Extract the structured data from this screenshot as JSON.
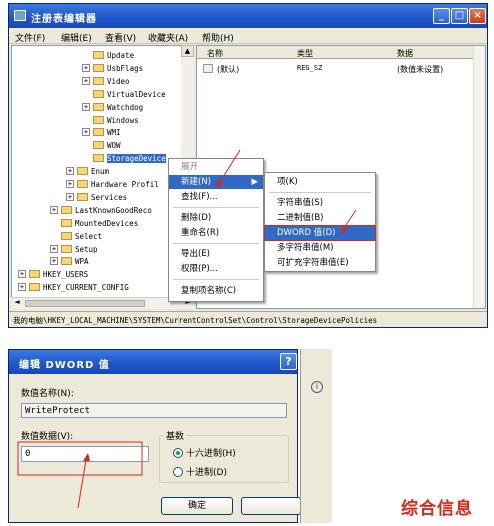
{
  "regedit": {
    "title": "注册表编辑器",
    "menu": [
      "文件(F)",
      "编辑(E)",
      "查看(V)",
      "收藏夹(A)",
      "帮助(H)"
    ],
    "tree": [
      {
        "label": "Update",
        "expander": ""
      },
      {
        "label": "UsbFlags",
        "expander": "+"
      },
      {
        "label": "Video",
        "expander": "+"
      },
      {
        "label": "VirtualDevice",
        "expander": ""
      },
      {
        "label": "Watchdog",
        "expander": "+"
      },
      {
        "label": "Windows",
        "expander": ""
      },
      {
        "label": "WMI",
        "expander": "+"
      },
      {
        "label": "WOW",
        "expander": ""
      },
      {
        "label": "StorageDevice",
        "expander": "",
        "selected": true
      },
      {
        "label": "Enum",
        "expander": "+"
      },
      {
        "label": "Hardware Profil",
        "expander": "+"
      },
      {
        "label": "Services",
        "expander": "+"
      },
      {
        "label": "LastKnownGoodReco",
        "expander": "+"
      },
      {
        "label": "MountedDevices",
        "expander": ""
      },
      {
        "label": "Select",
        "expander": ""
      },
      {
        "label": "Setup",
        "expander": "+"
      },
      {
        "label": "WPA",
        "expander": "+"
      },
      {
        "label": "HKEY_USERS",
        "expander": "+"
      },
      {
        "label": "HKEY_CURRENT_CONFIG",
        "expander": "+"
      }
    ],
    "columns": {
      "name": "名称",
      "type": "类型",
      "data": "数据"
    },
    "values": [
      {
        "name": "(默认)",
        "type": "REG_SZ",
        "data": "(数值未设置)"
      }
    ],
    "status": "我的电脑\\HKEY_LOCAL_MACHINE\\SYSTEM\\CurrentControlSet\\Control\\StorageDevicePolicies"
  },
  "context_menu": {
    "items": [
      {
        "label": "展开",
        "disabled": true
      },
      {
        "label": "新建(N)",
        "highlighted": true,
        "submenu": true
      },
      {
        "label": "查找(F)..."
      },
      {
        "label": "删除(D)"
      },
      {
        "label": "重命名(R)"
      },
      {
        "label": "导出(E)"
      },
      {
        "label": "权限(P)..."
      },
      {
        "label": "复制项名称(C)"
      }
    ]
  },
  "submenu": {
    "items": [
      {
        "label": "项(K)"
      },
      {
        "label": "字符串值(S)"
      },
      {
        "label": "二进制值(B)"
      },
      {
        "label": "DWORD 值(D)",
        "highlighted": true
      },
      {
        "label": "多字符串值(M)"
      },
      {
        "label": "可扩充字符串值(E)"
      }
    ]
  },
  "dword_dialog": {
    "title": "编辑 DWORD 值",
    "help_glyph": "?",
    "name_label": "数值名称(N):",
    "name_value": "WriteProtect",
    "data_label": "数值数据(V):",
    "data_value": "0",
    "base_label": "基数",
    "base_options": [
      {
        "label": "十六进制(H)",
        "selected": true
      },
      {
        "label": "十进制(D)",
        "selected": false
      }
    ],
    "ok_label": "确定"
  },
  "watermark": "综合信息",
  "colors": {
    "title_blue": "#1f55c8",
    "selection": "#316ac5",
    "annotation_red": "#d42a1e"
  }
}
